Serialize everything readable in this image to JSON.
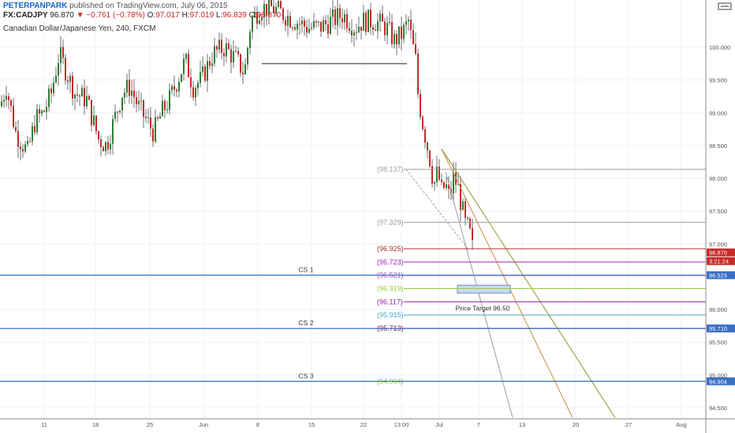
{
  "header": {
    "author": "PETERPANPARK",
    "published": "published on TradingView.com, July 06, 2015",
    "symbol": "FX:CADJPY",
    "last": "96.870",
    "change": "−0.761 (−0.78%)",
    "o_label": "O:",
    "o_value": "97.017",
    "h_label": "H:",
    "h_value": "97.019",
    "l_label": "L:",
    "l_value": "96.839",
    "c_label": "C:",
    "c_value": "96.870",
    "instrument": "Canadian Dollar/Japanese Yen, 240, FXCM"
  },
  "chart_data": {
    "type": "candlestick",
    "symbol": "FX:CADJPY",
    "timeframe": "240",
    "ylim": [
      94.35,
      100.4
    ],
    "y_ticks": [
      "94.500",
      "95.000",
      "95.500",
      "96.000",
      "96.500",
      "97.000",
      "97.500",
      "98.000",
      "98.500",
      "99.000",
      "99.500",
      "100.000"
    ],
    "x_ticks": [
      "11",
      "18",
      "25",
      "Jun",
      "8",
      "15",
      "22",
      "13:00",
      "Jul",
      "7",
      "13",
      "20",
      "27",
      "Aug"
    ],
    "price_path": [
      [
        0,
        99.1
      ],
      [
        8,
        99.4
      ],
      [
        20,
        98.7
      ],
      [
        35,
        98.4
      ],
      [
        45,
        98.9
      ],
      [
        55,
        99.0
      ],
      [
        65,
        99.3
      ],
      [
        75,
        99.9
      ],
      [
        85,
        99.6
      ],
      [
        95,
        99.3
      ],
      [
        110,
        99.2
      ],
      [
        125,
        98.6
      ],
      [
        135,
        98.5
      ],
      [
        145,
        98.9
      ],
      [
        155,
        99.3
      ],
      [
        165,
        99.4
      ],
      [
        175,
        99.1
      ],
      [
        185,
        98.9
      ],
      [
        195,
        98.7
      ],
      [
        205,
        99.0
      ],
      [
        215,
        99.2
      ],
      [
        225,
        99.5
      ],
      [
        235,
        99.8
      ],
      [
        245,
        99.4
      ],
      [
        255,
        99.5
      ],
      [
        270,
        99.9
      ],
      [
        285,
        100.0
      ],
      [
        300,
        99.8
      ],
      [
        310,
        99.6
      ],
      [
        318,
        100.4
      ],
      [
        330,
        100.6
      ],
      [
        345,
        100.6
      ],
      [
        360,
        100.5
      ],
      [
        375,
        100.4
      ],
      [
        390,
        100.3
      ],
      [
        405,
        100.3
      ],
      [
        420,
        100.4
      ],
      [
        435,
        100.5
      ],
      [
        450,
        100.3
      ],
      [
        460,
        100.4
      ],
      [
        475,
        100.4
      ],
      [
        490,
        100.3
      ],
      [
        500,
        100.1
      ],
      [
        510,
        100.2
      ],
      [
        518,
        100.4
      ],
      [
        522,
        100.1
      ],
      [
        527,
        99.8
      ],
      [
        530,
        99.3
      ],
      [
        535,
        98.9
      ],
      [
        540,
        98.6
      ],
      [
        545,
        98.3
      ],
      [
        550,
        97.9
      ],
      [
        555,
        98.1
      ],
      [
        560,
        97.8
      ],
      [
        565,
        97.9
      ],
      [
        570,
        97.7
      ],
      [
        575,
        98.0
      ],
      [
        580,
        97.9
      ],
      [
        585,
        97.6
      ],
      [
        590,
        97.3
      ],
      [
        595,
        97.2
      ],
      [
        600,
        96.87
      ]
    ],
    "horizontal_levels": [
      {
        "label": "(98.137)",
        "value": 98.137,
        "color": "#9e9e9e"
      },
      {
        "label": "(97.329)",
        "value": 97.329,
        "color": "#9e9e9e"
      },
      {
        "label": "(96.925)",
        "value": 96.925,
        "color": "#a03030"
      },
      {
        "label": "(96.723)",
        "value": 96.723,
        "color": "#9c27b0"
      },
      {
        "label": "(96.521)",
        "value": 96.521,
        "color": "#ab47bc"
      },
      {
        "label": "(96.319)",
        "value": 96.319,
        "color": "#9ccc3a"
      },
      {
        "label": "(96.117)",
        "value": 96.117,
        "color": "#8e24aa"
      },
      {
        "label": "(95.915)",
        "value": 95.915,
        "color": "#4fa8c8"
      },
      {
        "label": "(95.713)",
        "value": 95.713,
        "color": "#8b1a3a"
      },
      {
        "label": "(94.904)",
        "value": 94.904,
        "color": "#8bc34a"
      }
    ],
    "support_lines": [
      {
        "label": "CS 1",
        "value": 96.523,
        "axis_label": "96.523"
      },
      {
        "label": "CS 2",
        "value": 95.71,
        "axis_label": "95.710"
      },
      {
        "label": "CS 3",
        "value": 94.904,
        "axis_label": "94.904"
      }
    ],
    "price_target_label": "Price Target 96.50",
    "last_price_label": "96.870",
    "countdown_label": "3:21:24",
    "colors": {
      "up": "#2e7d32",
      "down": "#c62828",
      "support": "#3a6fc4",
      "target_box": "#c9dcf0"
    }
  }
}
